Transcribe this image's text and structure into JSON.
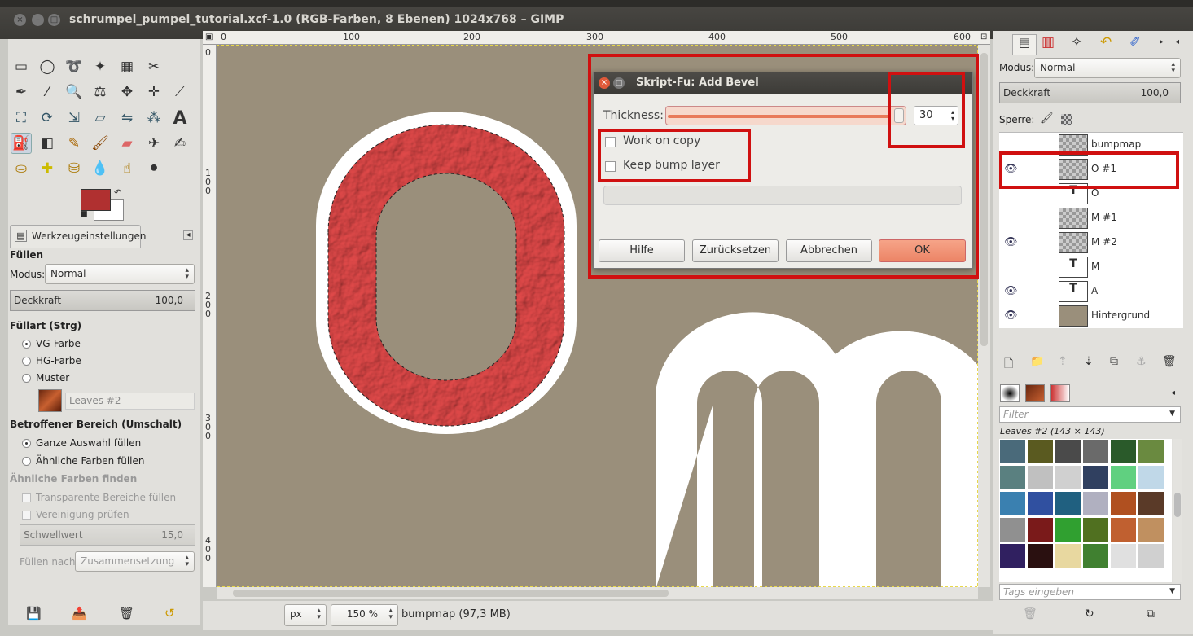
{
  "window": {
    "title": "schrumpel_pumpel_tutorial.xcf-1.0 (RGB-Farben, 8 Ebenen) 1024x768 – GIMP"
  },
  "toolbox": {
    "tools": [
      "rect-select",
      "ellipse-select",
      "free-select",
      "fuzzy-select",
      "color-select",
      "scissors",
      "paths",
      "color-picker",
      "zoom",
      "measure",
      "move",
      "align",
      "crop",
      "rotate",
      "scale",
      "shear",
      "perspective",
      "flip",
      "cage",
      "text",
      "bucket-fill",
      "blend",
      "pencil",
      "paintbrush",
      "eraser",
      "airbrush",
      "ink",
      "clone",
      "heal",
      "perspective-clone",
      "blur",
      "smudge",
      "dodge"
    ],
    "tab_label": "Werkzeugeinstellungen",
    "options": {
      "heading": "Füllen",
      "mode_label": "Modus:",
      "mode_value": "Normal",
      "opacity_label": "Deckkraft",
      "opacity_value": "100,0",
      "fill_type_label": "Füllart  (Strg)",
      "fill_fg": "VG-Farbe",
      "fill_bg": "HG-Farbe",
      "fill_pattern": "Muster",
      "pattern_name": "Leaves #2",
      "area_label": "Betroffener Bereich (Umschalt)",
      "area_whole": "Ganze Auswahl füllen",
      "area_similar": "Ähnliche Farben füllen",
      "similar_label": "Ähnliche Farben finden",
      "transparent": "Transparente Bereiche füllen",
      "merged": "Vereinigung prüfen",
      "threshold_label": "Schwellwert",
      "threshold_value": "15,0",
      "fill_by_label": "Füllen nach:",
      "fill_by_value": "Zusammensetzung"
    },
    "fg_color": "#b03030",
    "bg_color": "#ffffff"
  },
  "rulers": {
    "top": [
      "0",
      "100",
      "200",
      "300",
      "400",
      "500",
      "600"
    ],
    "left": [
      "0",
      "1\n0\n0",
      "2\n0\n0",
      "3\n0\n0",
      "4\n0\n0"
    ]
  },
  "statusbar": {
    "unit": "px",
    "zoom": "150 %",
    "info": "bumpmap (97,3 MB)"
  },
  "dialog": {
    "title": "Skript-Fu: Add Bevel",
    "thickness_label": "Thickness:",
    "thickness_value": "30",
    "thickness_fraction": 0.99,
    "work_on_copy": "Work on copy",
    "keep_bump": "Keep bump layer",
    "buttons": {
      "help": "Hilfe",
      "reset": "Zurücksetzen",
      "cancel": "Abbrechen",
      "ok": "OK"
    }
  },
  "layers_panel": {
    "mode_label": "Modus:",
    "mode_value": "Normal",
    "opacity_label": "Deckkraft",
    "opacity_value": "100,0",
    "lock_label": "Sperre:",
    "layers": [
      {
        "name": "bumpmap",
        "visible": false
      },
      {
        "name": "O #1",
        "visible": true
      },
      {
        "name": "O",
        "visible": false
      },
      {
        "name": "M #1",
        "visible": false
      },
      {
        "name": "M #2",
        "visible": true
      },
      {
        "name": "M",
        "visible": false
      },
      {
        "name": "A",
        "visible": true
      },
      {
        "name": "Hintergrund",
        "visible": true
      }
    ]
  },
  "patterns_panel": {
    "filter_placeholder": "Filter",
    "selected": "Leaves #2 (143 × 143)",
    "tags_placeholder": "Tags eingeben"
  },
  "colors": {
    "highlight": "#d01010",
    "canvas": "#9a8f7b",
    "ok_button": "#f09070"
  }
}
